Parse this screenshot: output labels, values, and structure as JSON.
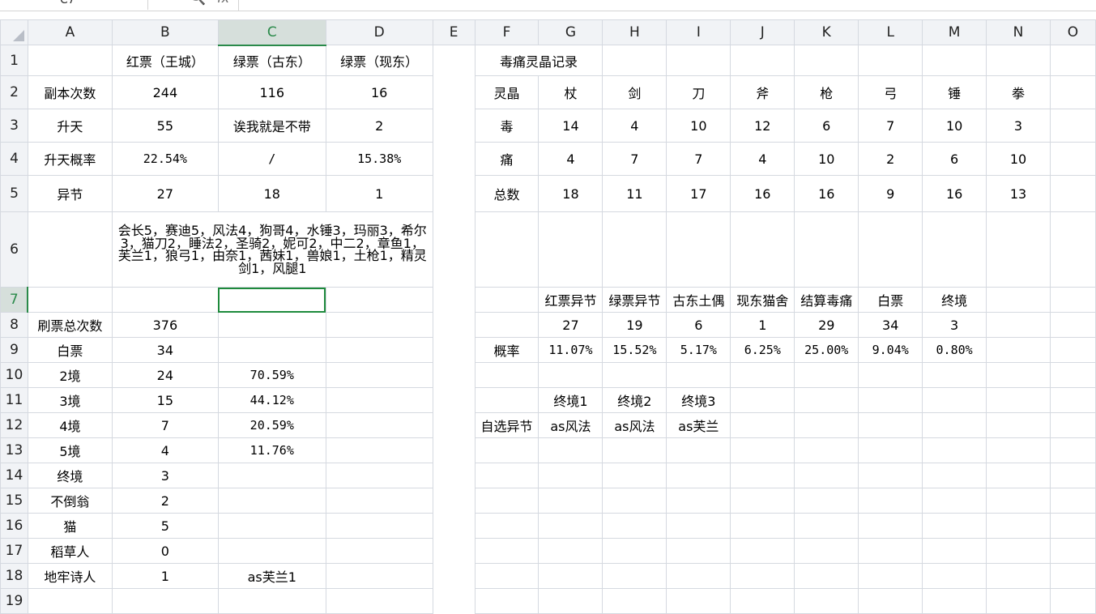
{
  "formula_bar": {
    "name_box": "C7",
    "zoom_icon": "zoom-icon",
    "fx_label": "fx",
    "formula": ""
  },
  "columns": [
    "A",
    "B",
    "C",
    "D",
    "E",
    "F",
    "G",
    "H",
    "I",
    "J",
    "K",
    "L",
    "M",
    "N",
    "O"
  ],
  "rows": [
    "1",
    "2",
    "3",
    "4",
    "5",
    "6",
    "7",
    "8",
    "9",
    "10",
    "11",
    "12",
    "13",
    "14",
    "15",
    "16",
    "17",
    "18",
    "19"
  ],
  "selected_cell": "C7",
  "left_table": {
    "headers": [
      "",
      "红票（王城）",
      "绿票（古东）",
      "绿票（现东）"
    ],
    "rows": [
      [
        "副本次数",
        "244",
        "116",
        "16"
      ],
      [
        "升天",
        "55",
        "诶我就是不带",
        "2"
      ],
      [
        "升天概率",
        "22.54%",
        "/",
        "15.38%"
      ],
      [
        "异节",
        "27",
        "18",
        "1"
      ]
    ],
    "row6_text": "会长5，赛迪5，风法4，狗哥4，水锤3，玛丽3，希尔3，猫刀2，睡法2，圣骑2，妮可2，中二2，章鱼1，芙兰1，狼弓1，由奈1，茜妹1，兽娘1，土枪1，精灵剑1，风腿1"
  },
  "lower_table": {
    "rows": [
      [
        "刷票总次数",
        "376",
        ""
      ],
      [
        "白票",
        "34",
        ""
      ],
      [
        "2境",
        "24",
        "70.59%"
      ],
      [
        "3境",
        "15",
        "44.12%"
      ],
      [
        "4境",
        "7",
        "20.59%"
      ],
      [
        "5境",
        "4",
        "11.76%"
      ],
      [
        "终境",
        "3",
        ""
      ],
      [
        "不倒翁",
        "2",
        ""
      ],
      [
        "猫",
        "5",
        ""
      ],
      [
        "稻草人",
        "0",
        ""
      ],
      [
        "地牢诗人",
        "1",
        "as芙兰1"
      ]
    ]
  },
  "right_table": {
    "title": "毒痛灵晶记录",
    "header": [
      "灵晶",
      "杖",
      "剑",
      "刀",
      "斧",
      "枪",
      "弓",
      "锤",
      "拳"
    ],
    "rows": [
      [
        "毒",
        "14",
        "4",
        "10",
        "12",
        "6",
        "7",
        "10",
        "3"
      ],
      [
        "痛",
        "4",
        "7",
        "7",
        "4",
        "10",
        "2",
        "6",
        "10"
      ],
      [
        "总数",
        "18",
        "11",
        "17",
        "16",
        "16",
        "9",
        "16",
        "13"
      ]
    ],
    "stats_header": [
      "红票异节",
      "绿票异节",
      "古东土偶",
      "现东猫舍",
      "结算毒痛",
      "白票",
      "终境"
    ],
    "stats_counts": [
      "27",
      "19",
      "6",
      "1",
      "29",
      "34",
      "3"
    ],
    "prob_label": "概率",
    "stats_probs": [
      "11.07%",
      "15.52%",
      "5.17%",
      "6.25%",
      "25.00%",
      "9.04%",
      "0.80%"
    ],
    "final_header": [
      "终境1",
      "终境2",
      "终境3"
    ],
    "final_label": "自选异节",
    "final_values": [
      "as风法",
      "as风法",
      "as芙兰"
    ]
  }
}
